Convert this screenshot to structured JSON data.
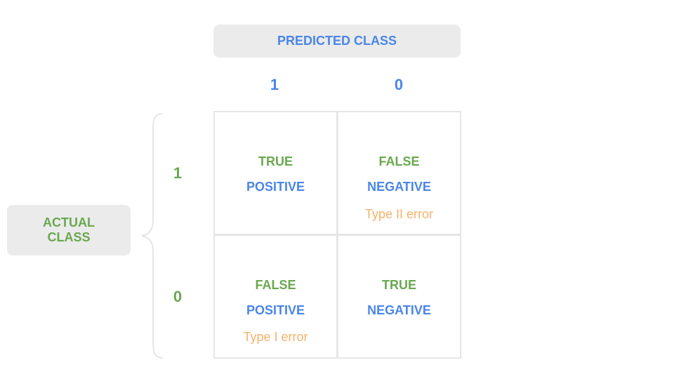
{
  "predicted_header": "PREDICTED CLASS",
  "actual_header": [
    "ACTUAL",
    "CLASS"
  ],
  "columns": [
    "1",
    "0"
  ],
  "rows": [
    "1",
    "0"
  ],
  "cells": [
    [
      {
        "line1": "TRUE",
        "line2": "POSITIVE",
        "note": ""
      },
      {
        "line1": "FALSE",
        "line2": "NEGATIVE",
        "note": "Type II error"
      }
    ],
    [
      {
        "line1": "FALSE",
        "line2": "POSITIVE",
        "note": "Type I error"
      },
      {
        "line1": "TRUE",
        "line2": "NEGATIVE",
        "note": ""
      }
    ]
  ],
  "colors": {
    "predicted": "#4a86e8",
    "actual": "#6aa84f",
    "error_note": "#f6b26b",
    "pill_bg": "#ebebeb",
    "grid_line": "#e6e6e6"
  }
}
